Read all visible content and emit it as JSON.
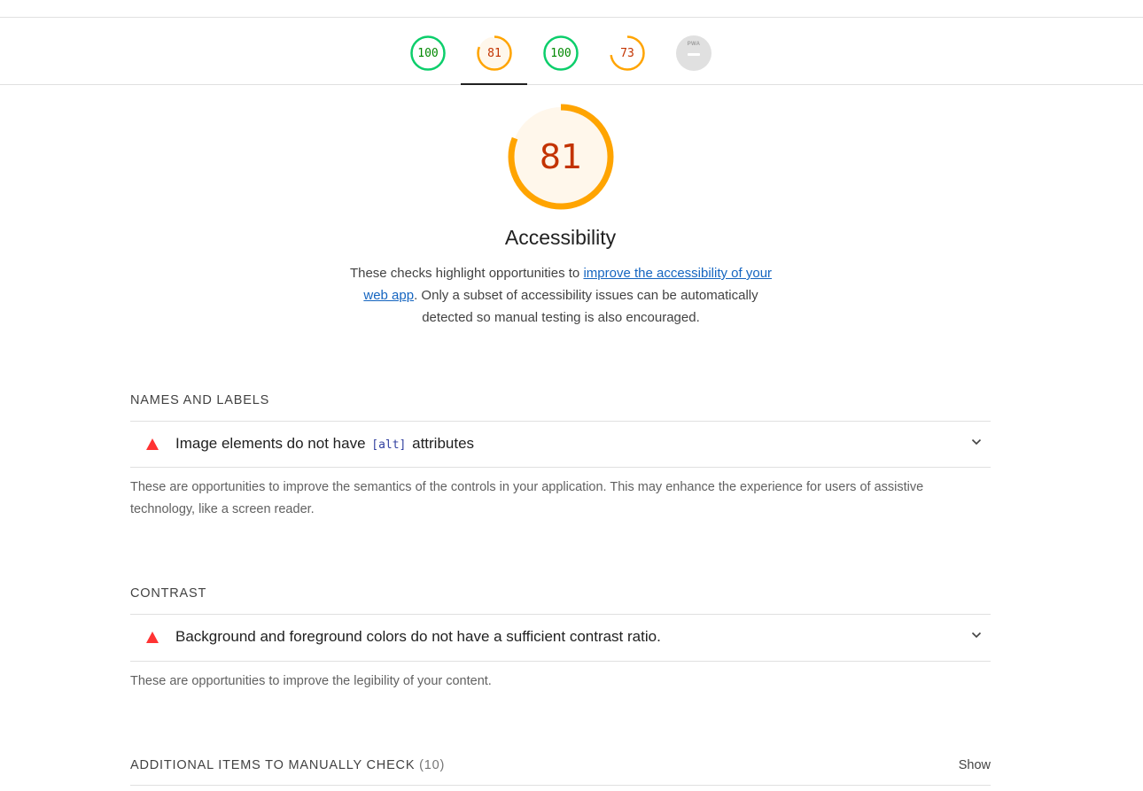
{
  "score_tabs": [
    {
      "name": "tab-performance",
      "score": "100",
      "value": 100,
      "color": "#0cce6b",
      "text_color": "#008800",
      "bg": "#ffffff"
    },
    {
      "name": "tab-accessibility",
      "score": "81",
      "value": 81,
      "color": "#ffa400",
      "text_color": "#c33300",
      "bg": "#fff7eb"
    },
    {
      "name": "tab-best-practices",
      "score": "100",
      "value": 100,
      "color": "#0cce6b",
      "text_color": "#008800",
      "bg": "#ffffff"
    },
    {
      "name": "tab-seo",
      "score": "73",
      "value": 73,
      "color": "#ffa400",
      "text_color": "#c33300",
      "bg": "#ffffff"
    },
    {
      "name": "tab-pwa",
      "pwa_label": "PWA",
      "icon": "pwa-icon",
      "color": "#e0e0e0"
    }
  ],
  "category": {
    "score": "81",
    "value": 81,
    "title": "Accessibility",
    "desc_before": "These checks highlight opportunities to ",
    "desc_link": "improve the accessibility of your web app",
    "desc_after": ". Only a subset of accessibility issues can be automatically detected so manual testing is also encouraged."
  },
  "groups": {
    "names_labels": {
      "title": "NAMES AND LABELS",
      "audit_before": "Image elements do not have ",
      "audit_code": "[alt]",
      "audit_after": " attributes",
      "description": "These are opportunities to improve the semantics of the controls in your application. This may enhance the experience for users of assistive technology, like a screen reader."
    },
    "contrast": {
      "title": "CONTRAST",
      "audit": "Background and foreground colors do not have a sufficient contrast ratio.",
      "description": "These are opportunities to improve the legibility of your content."
    },
    "manual": {
      "title": "ADDITIONAL ITEMS TO MANUALLY CHECK",
      "count": "(10)",
      "show_label": "Show"
    }
  },
  "icons": {
    "fail": "fail-triangle-icon",
    "expand": "chevron-down-icon"
  },
  "colors": {
    "fail": "#ff3333",
    "average": "#ffa400",
    "pass": "#0cce6b",
    "link": "#1565c0"
  }
}
